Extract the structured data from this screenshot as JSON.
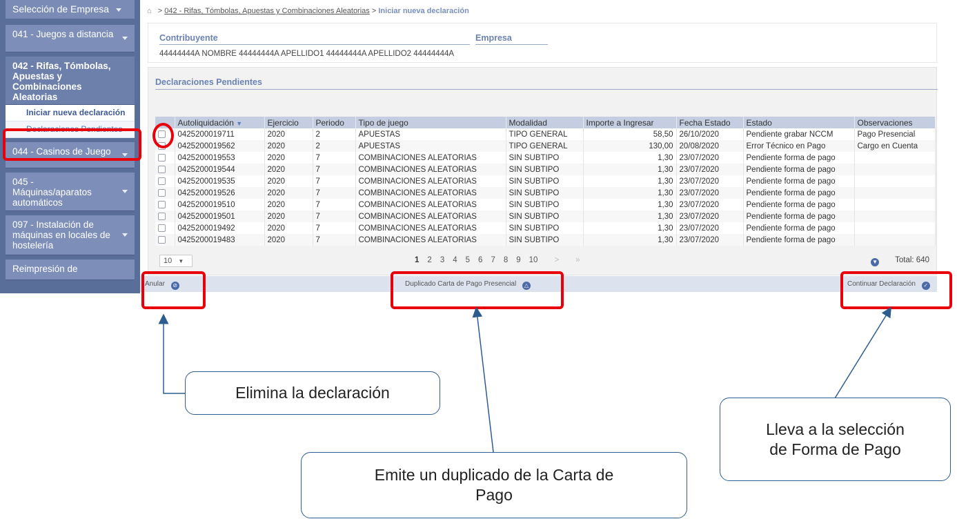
{
  "sidebar": {
    "company_selector": "Selección de Empresa",
    "menu": [
      {
        "label": "041 - Juegos a distancia"
      },
      {
        "label": "042 - Rifas, Tómbolas, Apuestas y Combinaciones Aleatorias",
        "submenu": [
          "Iniciar nueva declaración",
          "Declaraciones Pendientes"
        ]
      },
      {
        "label": "044 - Casinos de Juego"
      },
      {
        "label": "045 - Máquinas/aparatos automáticos"
      },
      {
        "label": "097 - Instalación de máquinas en locales de hostelería"
      },
      {
        "label": "Reimpresión de"
      }
    ]
  },
  "breadcrumb": {
    "separator": ">",
    "section": "042 - Rifas, Tómbolas, Apuestas y Combinaciones Aleatorias",
    "current": "Iniciar nueva declaración"
  },
  "contribuyente": {
    "label": "Contribuyente",
    "empresa_label": "Empresa",
    "value": "44444444A  NOMBRE 44444444A APELLIDO1 44444444A APELLIDO2 44444444A"
  },
  "declaraciones": {
    "title": "Declaraciones Pendientes",
    "columns": [
      "Autoliquidación",
      "Ejercicio",
      "Periodo",
      "Tipo de juego",
      "Modalidad",
      "Importe a Ingresar",
      "Fecha Estado",
      "Estado",
      "Observaciones"
    ],
    "sort_indicator": "▼",
    "rows": [
      [
        "0425200019711",
        "2020",
        "2",
        "APUESTAS",
        "TIPO GENERAL",
        "58,50",
        "26/10/2020",
        "Pendiente grabar NCCM",
        "Pago Presencial"
      ],
      [
        "0425200019562",
        "2020",
        "2",
        "APUESTAS",
        "TIPO GENERAL",
        "130,00",
        "20/08/2020",
        "Error Técnico en Pago",
        "Cargo en Cuenta"
      ],
      [
        "0425200019553",
        "2020",
        "7",
        "COMBINACIONES ALEATORIAS",
        "SIN SUBTIPO",
        "1,30",
        "23/07/2020",
        "Pendiente forma de pago",
        ""
      ],
      [
        "0425200019544",
        "2020",
        "7",
        "COMBINACIONES ALEATORIAS",
        "SIN SUBTIPO",
        "1,30",
        "23/07/2020",
        "Pendiente forma de pago",
        ""
      ],
      [
        "0425200019535",
        "2020",
        "7",
        "COMBINACIONES ALEATORIAS",
        "SIN SUBTIPO",
        "1,30",
        "23/07/2020",
        "Pendiente forma de pago",
        ""
      ],
      [
        "0425200019526",
        "2020",
        "7",
        "COMBINACIONES ALEATORIAS",
        "SIN SUBTIPO",
        "1,30",
        "23/07/2020",
        "Pendiente forma de pago",
        ""
      ],
      [
        "0425200019510",
        "2020",
        "7",
        "COMBINACIONES ALEATORIAS",
        "SIN SUBTIPO",
        "1,30",
        "23/07/2020",
        "Pendiente forma de pago",
        ""
      ],
      [
        "0425200019501",
        "2020",
        "7",
        "COMBINACIONES ALEATORIAS",
        "SIN SUBTIPO",
        "1,30",
        "23/07/2020",
        "Pendiente forma de pago",
        ""
      ],
      [
        "0425200019492",
        "2020",
        "7",
        "COMBINACIONES ALEATORIAS",
        "SIN SUBTIPO",
        "1,30",
        "23/07/2020",
        "Pendiente forma de pago",
        ""
      ],
      [
        "0425200019483",
        "2020",
        "7",
        "COMBINACIONES ALEATORIAS",
        "SIN SUBTIPO",
        "1,30",
        "23/07/2020",
        "Pendiente forma de pago",
        ""
      ]
    ]
  },
  "pager": {
    "page_size": "10",
    "pages": [
      "1",
      "2",
      "3",
      "4",
      "5",
      "6",
      "7",
      "8",
      "9",
      "10"
    ],
    "next": ">",
    "last": "»",
    "total": "Total: 640"
  },
  "actions": {
    "anular": "Anular",
    "duplicado": "Duplicado Carta de Pago Presencial",
    "continuar": "Continuar Declaración"
  },
  "callouts": {
    "elimina": "Elimina la declaración",
    "duplicado_line1": "Emite un duplicado de la Carta de",
    "duplicado_line2": "Pago",
    "lleva_line1": "Lleva a la selección",
    "lleva_line2": "de Forma de Pago"
  },
  "colors": {
    "highlight": "#e8000b",
    "arrow": "#2d5d8f",
    "sidebar": "#5a6e9a",
    "accent": "#6b82b3"
  }
}
